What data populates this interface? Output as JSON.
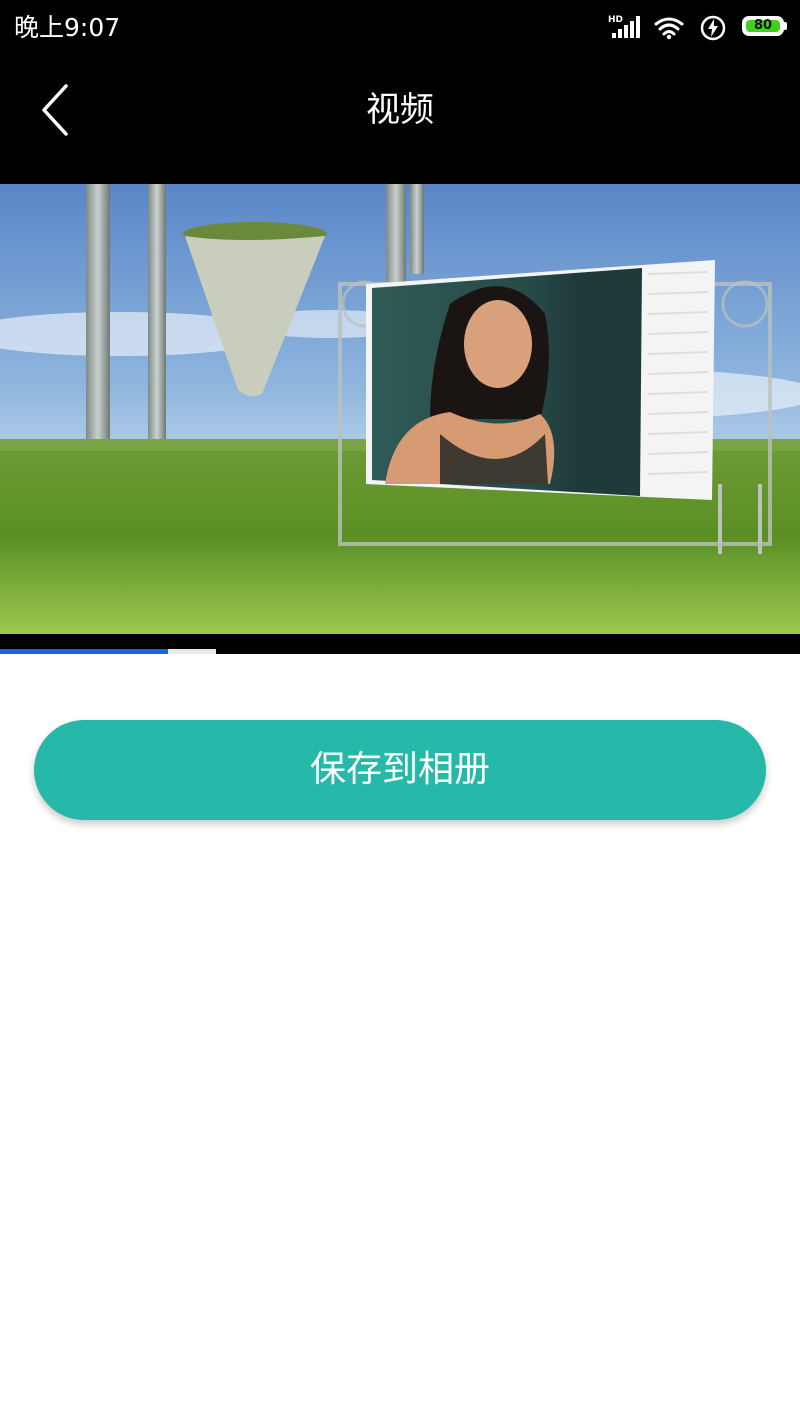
{
  "status_bar": {
    "time": "晚上9:07",
    "network_label": "HD",
    "battery_level": "80",
    "icons": [
      "signal-icon",
      "wifi-icon",
      "charging-icon",
      "battery-icon"
    ]
  },
  "nav": {
    "title": "视频",
    "back_icon": "chevron-left-icon"
  },
  "video": {
    "progress_played": 0.21,
    "progress_buffered": 0.27
  },
  "actions": {
    "save_label": "保存到相册"
  },
  "colors": {
    "accent": "#26b8a8",
    "progress": "#1c63e0",
    "battery": "#3fcf1e"
  }
}
